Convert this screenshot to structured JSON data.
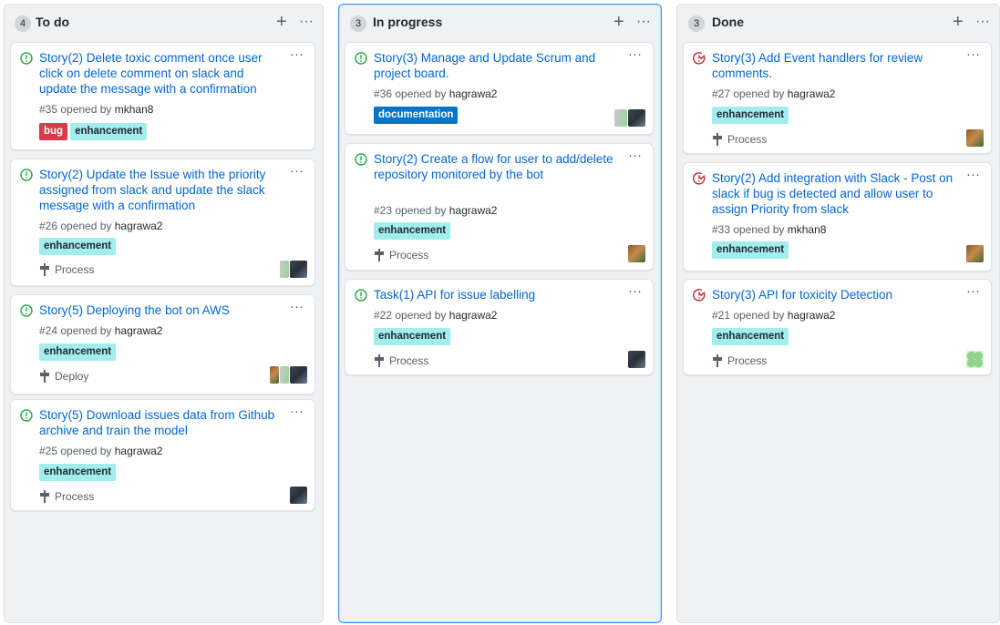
{
  "board": {
    "menu_glyph": "···",
    "add_glyph": "+",
    "columns": [
      {
        "count": "4",
        "title": "To do",
        "cards": [
          {
            "title": "Story(2) Delete toxic comment once user click on delete comment on slack and update the message with a confirmation",
            "meta_prefix": "#35 opened by",
            "author": "mkhan8",
            "labels": [
              "bug",
              "enhancement"
            ]
          },
          {
            "title": "Story(2) Update the Issue with the priority assigned from slack and update the slack message with a confirmation",
            "meta_prefix": "#26 opened by",
            "author": "hagrawa2",
            "labels": [
              "enhancement"
            ],
            "milestone": "Process"
          },
          {
            "title": "Story(5) Deploying the bot on AWS",
            "meta_prefix": "#24 opened by",
            "author": "hagrawa2",
            "labels": [
              "enhancement"
            ],
            "milestone": "Deploy"
          },
          {
            "title": "Story(5) Download issues data from Github archive and train the model",
            "meta_prefix": "#25 opened by",
            "author": "hagrawa2",
            "labels": [
              "enhancement"
            ],
            "milestone": "Process"
          }
        ]
      },
      {
        "count": "3",
        "title": "In progress",
        "cards": [
          {
            "title": "Story(3) Manage and Update Scrum and project board.",
            "meta_prefix": "#36 opened by",
            "author": "hagrawa2",
            "labels": [
              "documentation"
            ]
          },
          {
            "title": "Story(2) Create a flow for user to add/delete repository monitored by the bot",
            "meta_prefix": "#23 opened by",
            "author": "hagrawa2",
            "labels": [
              "enhancement"
            ],
            "milestone": "Process"
          },
          {
            "title": "Task(1) API for issue labelling",
            "meta_prefix": "#22 opened by",
            "author": "hagrawa2",
            "labels": [
              "enhancement"
            ],
            "milestone": "Process"
          }
        ]
      },
      {
        "count": "3",
        "title": "Done",
        "cards": [
          {
            "title": "Story(3) Add Event handlers for review comments.",
            "meta_prefix": "#27 opened by",
            "author": "hagrawa2",
            "labels": [
              "enhancement"
            ],
            "milestone": "Process"
          },
          {
            "title": "Story(2) Add integration with Slack - Post on slack if bug is detected and allow user to assign Priority from slack",
            "meta_prefix": "#33 opened by",
            "author": "mkhan8",
            "labels": [
              "enhancement"
            ]
          },
          {
            "title": "Story(3) API for toxicity Detection",
            "meta_prefix": "#21 opened by",
            "author": "hagrawa2",
            "labels": [
              "enhancement"
            ],
            "milestone": "Process"
          }
        ]
      }
    ]
  },
  "colors": {
    "open_issue": "#28a745",
    "closed_issue": "#cb2431",
    "link": "#0366d6",
    "label_bug": "#d73a4a",
    "label_enhancement": "#a2eeef",
    "label_documentation": "#0075ca"
  },
  "icons": {
    "open": "issue-opened-icon",
    "closed": "issue-closed-icon",
    "milestone": "milestone-icon",
    "kebab": "kebab-horizontal-icon",
    "plus": "plus-icon"
  }
}
